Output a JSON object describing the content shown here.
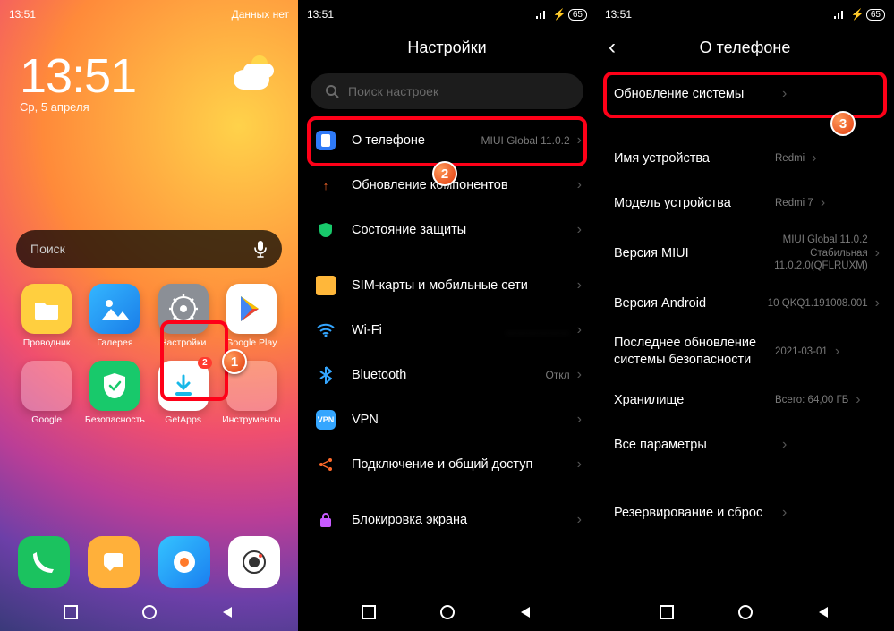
{
  "screen1": {
    "status_time": "13:51",
    "status_right": "Данных нет",
    "clock_time": "13:51",
    "clock_date": "Ср, 5 апреля",
    "search_placeholder": "Поиск",
    "apps_row1": [
      "Проводник",
      "Галерея",
      "Настройки",
      "Google Play"
    ],
    "apps_row2": [
      "Google",
      "Безопасность",
      "GetApps",
      "Инструменты"
    ],
    "step": "1"
  },
  "screen2": {
    "status_time": "13:51",
    "battery": "65",
    "title": "Настройки",
    "search_placeholder": "Поиск настроек",
    "rows": [
      {
        "icon": "phone",
        "label": "О телефоне",
        "value": "MIUI Global 11.0.2"
      },
      {
        "icon": "update",
        "label": "Обновление компонентов",
        "value": ""
      },
      {
        "icon": "shield",
        "label": "Состояние защиты",
        "value": ""
      },
      {
        "icon": "sim",
        "label": "SIM-карты и мобильные сети",
        "value": ""
      },
      {
        "icon": "wifi",
        "label": "Wi-Fi",
        "value": ""
      },
      {
        "icon": "bt",
        "label": "Bluetooth",
        "value": "Откл"
      },
      {
        "icon": "vpn",
        "label": "VPN",
        "value": ""
      },
      {
        "icon": "share",
        "label": "Подключение и общий доступ",
        "value": ""
      },
      {
        "icon": "lock",
        "label": "Блокировка экрана",
        "value": ""
      }
    ],
    "step": "2"
  },
  "screen3": {
    "status_time": "13:51",
    "battery": "65",
    "title": "О телефоне",
    "system_update": "Обновление системы",
    "rows": [
      {
        "label": "Имя устройства",
        "value": "Redmi"
      },
      {
        "label": "Модель устройства",
        "value": "Redmi 7"
      },
      {
        "label": "Версия MIUI",
        "value": "MIUI Global 11.0.2\nСтабильная\n11.0.2.0(QFLRUXM)"
      },
      {
        "label": "Версия Android",
        "value": "10 QKQ1.191008.001"
      },
      {
        "label": "Последнее обновление системы безопасности",
        "value": "2021-03-01"
      },
      {
        "label": "Хранилище",
        "value": "Всего: 64,00 ГБ"
      },
      {
        "label": "Все параметры",
        "value": ""
      },
      {
        "label": "Резервирование и сброс",
        "value": ""
      }
    ],
    "step": "3"
  }
}
